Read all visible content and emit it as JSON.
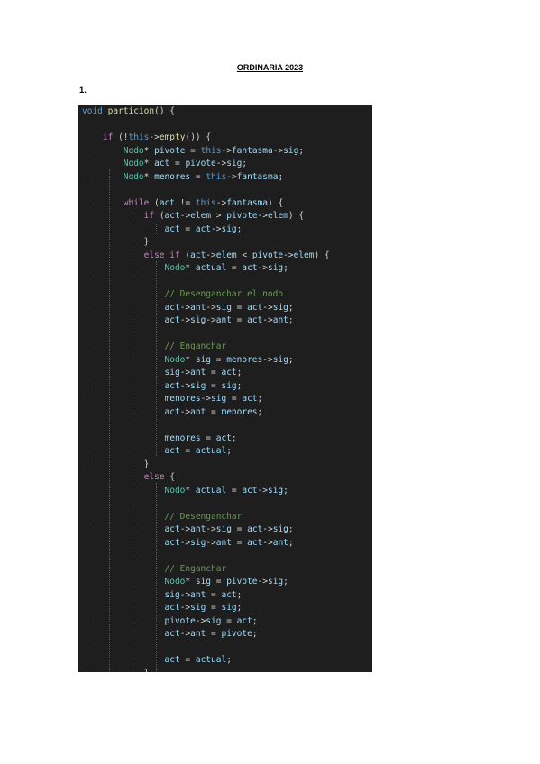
{
  "document": {
    "title": "ORDINARIA 2023",
    "question_number": "1."
  },
  "colors": {
    "editor_background": "#1e1e1e",
    "keyword": "#569cd6",
    "control": "#c586c0",
    "type": "#4ec9b0",
    "function": "#dcdcaa",
    "variable": "#9cdcfe",
    "comment": "#6a9955",
    "text": "#d4d4d4"
  },
  "code": {
    "language": "cpp",
    "lines": [
      [
        [
          "kw",
          "void"
        ],
        [
          "pl",
          " "
        ],
        [
          "fn",
          "particion"
        ],
        [
          "pl",
          "() {"
        ]
      ],
      [],
      [
        [
          "pl",
          "    "
        ],
        [
          "ctl",
          "if"
        ],
        [
          "pl",
          " (!"
        ],
        [
          "kw",
          "this"
        ],
        [
          "op",
          "->"
        ],
        [
          "fn",
          "empty"
        ],
        [
          "pl",
          "()) {"
        ]
      ],
      [
        [
          "pl",
          "        "
        ],
        [
          "type",
          "Nodo"
        ],
        [
          "pl",
          "* "
        ],
        [
          "var",
          "pivote"
        ],
        [
          "pl",
          " = "
        ],
        [
          "kw",
          "this"
        ],
        [
          "op",
          "->"
        ],
        [
          "var",
          "fantasma"
        ],
        [
          "op",
          "->"
        ],
        [
          "var",
          "sig"
        ],
        [
          "pl",
          ";"
        ]
      ],
      [
        [
          "pl",
          "        "
        ],
        [
          "type",
          "Nodo"
        ],
        [
          "pl",
          "* "
        ],
        [
          "var",
          "act"
        ],
        [
          "pl",
          " = "
        ],
        [
          "var",
          "pivote"
        ],
        [
          "op",
          "->"
        ],
        [
          "var",
          "sig"
        ],
        [
          "pl",
          ";"
        ]
      ],
      [
        [
          "pl",
          "        "
        ],
        [
          "type",
          "Nodo"
        ],
        [
          "pl",
          "* "
        ],
        [
          "var",
          "menores"
        ],
        [
          "pl",
          " = "
        ],
        [
          "kw",
          "this"
        ],
        [
          "op",
          "->"
        ],
        [
          "var",
          "fantasma"
        ],
        [
          "pl",
          ";"
        ]
      ],
      [],
      [
        [
          "pl",
          "        "
        ],
        [
          "ctl",
          "while"
        ],
        [
          "pl",
          " ("
        ],
        [
          "var",
          "act"
        ],
        [
          "pl",
          " != "
        ],
        [
          "kw",
          "this"
        ],
        [
          "op",
          "->"
        ],
        [
          "var",
          "fantasma"
        ],
        [
          "pl",
          ") {"
        ]
      ],
      [
        [
          "pl",
          "            "
        ],
        [
          "ctl",
          "if"
        ],
        [
          "pl",
          " ("
        ],
        [
          "var",
          "act"
        ],
        [
          "op",
          "->"
        ],
        [
          "var",
          "elem"
        ],
        [
          "pl",
          " > "
        ],
        [
          "var",
          "pivote"
        ],
        [
          "op",
          "->"
        ],
        [
          "var",
          "elem"
        ],
        [
          "pl",
          ") {"
        ]
      ],
      [
        [
          "pl",
          "                "
        ],
        [
          "var",
          "act"
        ],
        [
          "pl",
          " = "
        ],
        [
          "var",
          "act"
        ],
        [
          "op",
          "->"
        ],
        [
          "var",
          "sig"
        ],
        [
          "pl",
          ";"
        ]
      ],
      [
        [
          "pl",
          "            }"
        ]
      ],
      [
        [
          "pl",
          "            "
        ],
        [
          "ctl",
          "else if"
        ],
        [
          "pl",
          " ("
        ],
        [
          "var",
          "act"
        ],
        [
          "op",
          "->"
        ],
        [
          "var",
          "elem"
        ],
        [
          "pl",
          " < "
        ],
        [
          "var",
          "pivote"
        ],
        [
          "op",
          "->"
        ],
        [
          "var",
          "elem"
        ],
        [
          "pl",
          ") {"
        ]
      ],
      [
        [
          "pl",
          "                "
        ],
        [
          "type",
          "Nodo"
        ],
        [
          "pl",
          "* "
        ],
        [
          "var",
          "actual"
        ],
        [
          "pl",
          " = "
        ],
        [
          "var",
          "act"
        ],
        [
          "op",
          "->"
        ],
        [
          "var",
          "sig"
        ],
        [
          "pl",
          ";"
        ]
      ],
      [],
      [
        [
          "pl",
          "                "
        ],
        [
          "cmt",
          "// Desenganchar el nodo"
        ]
      ],
      [
        [
          "pl",
          "                "
        ],
        [
          "var",
          "act"
        ],
        [
          "op",
          "->"
        ],
        [
          "var",
          "ant"
        ],
        [
          "op",
          "->"
        ],
        [
          "var",
          "sig"
        ],
        [
          "pl",
          " = "
        ],
        [
          "var",
          "act"
        ],
        [
          "op",
          "->"
        ],
        [
          "var",
          "sig"
        ],
        [
          "pl",
          ";"
        ]
      ],
      [
        [
          "pl",
          "                "
        ],
        [
          "var",
          "act"
        ],
        [
          "op",
          "->"
        ],
        [
          "var",
          "sig"
        ],
        [
          "op",
          "->"
        ],
        [
          "var",
          "ant"
        ],
        [
          "pl",
          " = "
        ],
        [
          "var",
          "act"
        ],
        [
          "op",
          "->"
        ],
        [
          "var",
          "ant"
        ],
        [
          "pl",
          ";"
        ]
      ],
      [],
      [
        [
          "pl",
          "                "
        ],
        [
          "cmt",
          "// Enganchar"
        ]
      ],
      [
        [
          "pl",
          "                "
        ],
        [
          "type",
          "Nodo"
        ],
        [
          "pl",
          "* "
        ],
        [
          "var",
          "sig"
        ],
        [
          "pl",
          " = "
        ],
        [
          "var",
          "menores"
        ],
        [
          "op",
          "->"
        ],
        [
          "var",
          "sig"
        ],
        [
          "pl",
          ";"
        ]
      ],
      [
        [
          "pl",
          "                "
        ],
        [
          "var",
          "sig"
        ],
        [
          "op",
          "->"
        ],
        [
          "var",
          "ant"
        ],
        [
          "pl",
          " = "
        ],
        [
          "var",
          "act"
        ],
        [
          "pl",
          ";"
        ]
      ],
      [
        [
          "pl",
          "                "
        ],
        [
          "var",
          "act"
        ],
        [
          "op",
          "->"
        ],
        [
          "var",
          "sig"
        ],
        [
          "pl",
          " = "
        ],
        [
          "var",
          "sig"
        ],
        [
          "pl",
          ";"
        ]
      ],
      [
        [
          "pl",
          "                "
        ],
        [
          "var",
          "menores"
        ],
        [
          "op",
          "->"
        ],
        [
          "var",
          "sig"
        ],
        [
          "pl",
          " = "
        ],
        [
          "var",
          "act"
        ],
        [
          "pl",
          ";"
        ]
      ],
      [
        [
          "pl",
          "                "
        ],
        [
          "var",
          "act"
        ],
        [
          "op",
          "->"
        ],
        [
          "var",
          "ant"
        ],
        [
          "pl",
          " = "
        ],
        [
          "var",
          "menores"
        ],
        [
          "pl",
          ";"
        ]
      ],
      [],
      [
        [
          "pl",
          "                "
        ],
        [
          "var",
          "menores"
        ],
        [
          "pl",
          " = "
        ],
        [
          "var",
          "act"
        ],
        [
          "pl",
          ";"
        ]
      ],
      [
        [
          "pl",
          "                "
        ],
        [
          "var",
          "act"
        ],
        [
          "pl",
          " = "
        ],
        [
          "var",
          "actual"
        ],
        [
          "pl",
          ";"
        ]
      ],
      [
        [
          "pl",
          "            }"
        ]
      ],
      [
        [
          "pl",
          "            "
        ],
        [
          "ctl",
          "else"
        ],
        [
          "pl",
          " {"
        ]
      ],
      [
        [
          "pl",
          "                "
        ],
        [
          "type",
          "Nodo"
        ],
        [
          "pl",
          "* "
        ],
        [
          "var",
          "actual"
        ],
        [
          "pl",
          " = "
        ],
        [
          "var",
          "act"
        ],
        [
          "op",
          "->"
        ],
        [
          "var",
          "sig"
        ],
        [
          "pl",
          ";"
        ]
      ],
      [],
      [
        [
          "pl",
          "                "
        ],
        [
          "cmt",
          "// Desenganchar"
        ]
      ],
      [
        [
          "pl",
          "                "
        ],
        [
          "var",
          "act"
        ],
        [
          "op",
          "->"
        ],
        [
          "var",
          "ant"
        ],
        [
          "op",
          "->"
        ],
        [
          "var",
          "sig"
        ],
        [
          "pl",
          " = "
        ],
        [
          "var",
          "act"
        ],
        [
          "op",
          "->"
        ],
        [
          "var",
          "sig"
        ],
        [
          "pl",
          ";"
        ]
      ],
      [
        [
          "pl",
          "                "
        ],
        [
          "var",
          "act"
        ],
        [
          "op",
          "->"
        ],
        [
          "var",
          "sig"
        ],
        [
          "op",
          "->"
        ],
        [
          "var",
          "ant"
        ],
        [
          "pl",
          " = "
        ],
        [
          "var",
          "act"
        ],
        [
          "op",
          "->"
        ],
        [
          "var",
          "ant"
        ],
        [
          "pl",
          ";"
        ]
      ],
      [],
      [
        [
          "pl",
          "                "
        ],
        [
          "cmt",
          "// Enganchar"
        ]
      ],
      [
        [
          "pl",
          "                "
        ],
        [
          "type",
          "Nodo"
        ],
        [
          "pl",
          "* "
        ],
        [
          "var",
          "sig"
        ],
        [
          "pl",
          " = "
        ],
        [
          "var",
          "pivote"
        ],
        [
          "op",
          "->"
        ],
        [
          "var",
          "sig"
        ],
        [
          "pl",
          ";"
        ]
      ],
      [
        [
          "pl",
          "                "
        ],
        [
          "var",
          "sig"
        ],
        [
          "op",
          "->"
        ],
        [
          "var",
          "ant"
        ],
        [
          "pl",
          " = "
        ],
        [
          "var",
          "act"
        ],
        [
          "pl",
          ";"
        ]
      ],
      [
        [
          "pl",
          "                "
        ],
        [
          "var",
          "act"
        ],
        [
          "op",
          "->"
        ],
        [
          "var",
          "sig"
        ],
        [
          "pl",
          " = "
        ],
        [
          "var",
          "sig"
        ],
        [
          "pl",
          ";"
        ]
      ],
      [
        [
          "pl",
          "                "
        ],
        [
          "var",
          "pivote"
        ],
        [
          "op",
          "->"
        ],
        [
          "var",
          "sig"
        ],
        [
          "pl",
          " = "
        ],
        [
          "var",
          "act"
        ],
        [
          "pl",
          ";"
        ]
      ],
      [
        [
          "pl",
          "                "
        ],
        [
          "var",
          "act"
        ],
        [
          "op",
          "->"
        ],
        [
          "var",
          "ant"
        ],
        [
          "pl",
          " = "
        ],
        [
          "var",
          "pivote"
        ],
        [
          "pl",
          ";"
        ]
      ],
      [],
      [
        [
          "pl",
          "                "
        ],
        [
          "var",
          "act"
        ],
        [
          "pl",
          " = "
        ],
        [
          "var",
          "actual"
        ],
        [
          "pl",
          ";"
        ]
      ],
      [
        [
          "pl",
          "            }"
        ]
      ]
    ]
  }
}
